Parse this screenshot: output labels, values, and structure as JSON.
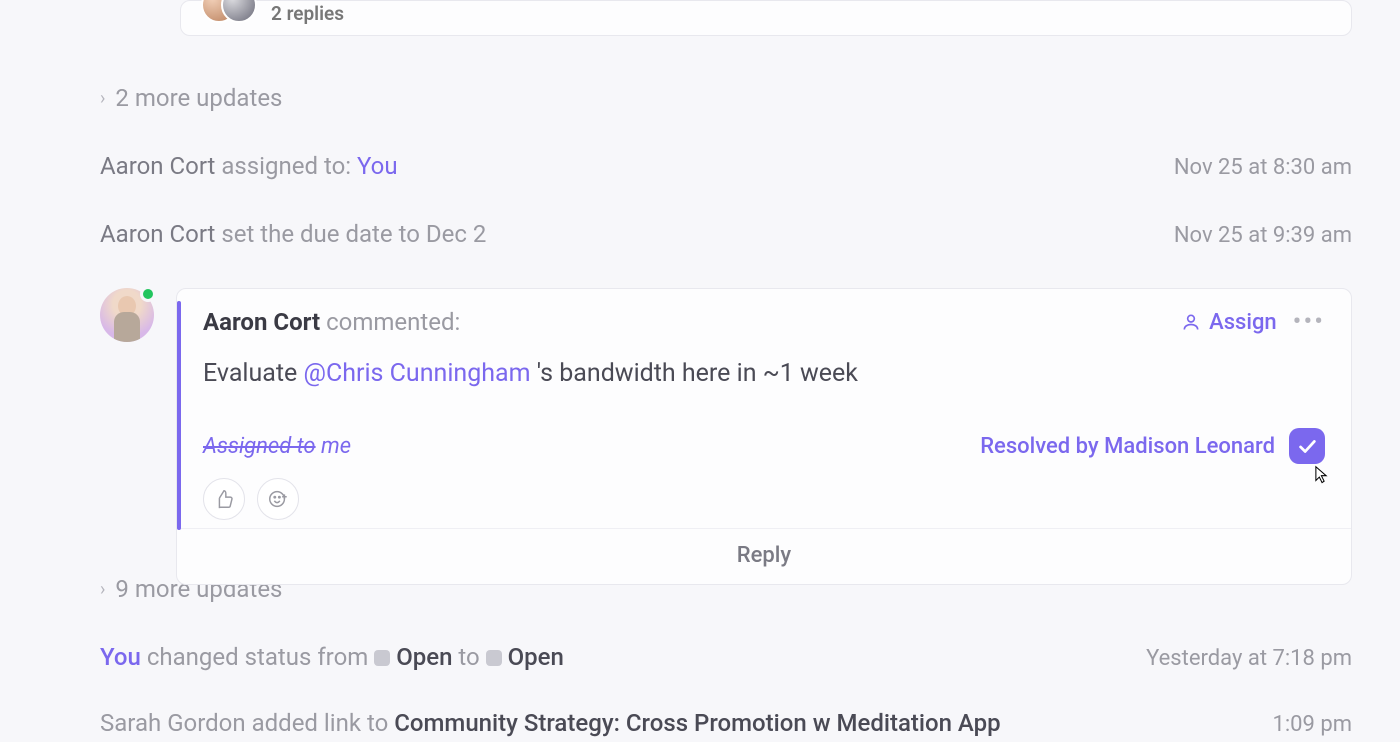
{
  "replies_card": {
    "count_text": "2 replies"
  },
  "more_updates_1": {
    "text": "2 more updates"
  },
  "log_assigned": {
    "actor": "Aaron Cort",
    "verb": " assigned to: ",
    "target": "You",
    "ts": "Nov 25 at 8:30 am"
  },
  "log_duedate": {
    "actor": "Aaron Cort",
    "verb": " set the due date to Dec 2",
    "ts": "Nov 25 at 9:39 am"
  },
  "comment": {
    "author": "Aaron Cort",
    "verb": " commented:",
    "body_pre": "Evaluate ",
    "mention": "@Chris Cunningham",
    "body_post": " 's bandwidth here in ~1 week",
    "assigned_strike": "Assigned to",
    "assigned_me": " me",
    "resolved_by": "Resolved by Madison Leonard",
    "assign_label": "Assign",
    "reply_label": "Reply"
  },
  "more_updates_2": {
    "text": "9 more updates"
  },
  "status_row": {
    "actor": "You",
    "verb": " changed status from ",
    "from": "Open",
    "to_word": " to ",
    "to": "Open",
    "ts": "Yesterday at 7:18 pm"
  },
  "link_row": {
    "actor": "Sarah Gordon",
    "verb": " added link to ",
    "title": "Community Strategy: Cross Promotion w Meditation App",
    "ts": "1:09 pm"
  }
}
